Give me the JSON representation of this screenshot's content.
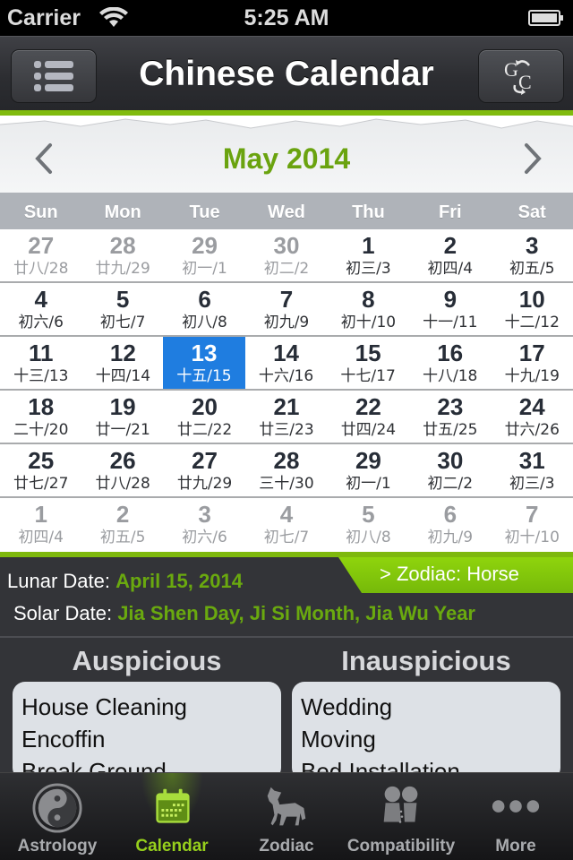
{
  "status_bar": {
    "carrier": "Carrier",
    "time": "5:25 AM",
    "wifi_icon": "wifi-icon",
    "battery_icon": "battery-icon"
  },
  "nav": {
    "title": "Chinese Calendar",
    "left_button_icon": "list-icon",
    "right_button_icon": "gregorian-chinese-convert-icon"
  },
  "calendar": {
    "month_title": "May 2014",
    "prev_icon": "chevron-left-icon",
    "next_icon": "chevron-right-icon",
    "weekdays": [
      "Sun",
      "Mon",
      "Tue",
      "Wed",
      "Thu",
      "Fri",
      "Sat"
    ],
    "selected_color": "#1f7de0",
    "weeks": [
      [
        {
          "solar": "27",
          "lunar": "廿八/28",
          "other": true
        },
        {
          "solar": "28",
          "lunar": "廿九/29",
          "other": true
        },
        {
          "solar": "29",
          "lunar": "初一/1",
          "other": true
        },
        {
          "solar": "30",
          "lunar": "初二/2",
          "other": true
        },
        {
          "solar": "1",
          "lunar": "初三/3",
          "other": false
        },
        {
          "solar": "2",
          "lunar": "初四/4",
          "other": false
        },
        {
          "solar": "3",
          "lunar": "初五/5",
          "other": false
        }
      ],
      [
        {
          "solar": "4",
          "lunar": "初六/6",
          "other": false
        },
        {
          "solar": "5",
          "lunar": "初七/7",
          "other": false
        },
        {
          "solar": "6",
          "lunar": "初八/8",
          "other": false
        },
        {
          "solar": "7",
          "lunar": "初九/9",
          "other": false
        },
        {
          "solar": "8",
          "lunar": "初十/10",
          "other": false
        },
        {
          "solar": "9",
          "lunar": "十一/11",
          "other": false
        },
        {
          "solar": "10",
          "lunar": "十二/12",
          "other": false
        }
      ],
      [
        {
          "solar": "11",
          "lunar": "十三/13",
          "other": false
        },
        {
          "solar": "12",
          "lunar": "十四/14",
          "other": false
        },
        {
          "solar": "13",
          "lunar": "十五/15",
          "other": false,
          "selected": true
        },
        {
          "solar": "14",
          "lunar": "十六/16",
          "other": false
        },
        {
          "solar": "15",
          "lunar": "十七/17",
          "other": false
        },
        {
          "solar": "16",
          "lunar": "十八/18",
          "other": false
        },
        {
          "solar": "17",
          "lunar": "十九/19",
          "other": false
        }
      ],
      [
        {
          "solar": "18",
          "lunar": "二十/20",
          "other": false
        },
        {
          "solar": "19",
          "lunar": "廿一/21",
          "other": false
        },
        {
          "solar": "20",
          "lunar": "廿二/22",
          "other": false
        },
        {
          "solar": "21",
          "lunar": "廿三/23",
          "other": false
        },
        {
          "solar": "22",
          "lunar": "廿四/24",
          "other": false
        },
        {
          "solar": "23",
          "lunar": "廿五/25",
          "other": false
        },
        {
          "solar": "24",
          "lunar": "廿六/26",
          "other": false
        }
      ],
      [
        {
          "solar": "25",
          "lunar": "廿七/27",
          "other": false
        },
        {
          "solar": "26",
          "lunar": "廿八/28",
          "other": false
        },
        {
          "solar": "27",
          "lunar": "廿九/29",
          "other": false
        },
        {
          "solar": "28",
          "lunar": "三十/30",
          "other": false
        },
        {
          "solar": "29",
          "lunar": "初一/1",
          "other": false
        },
        {
          "solar": "30",
          "lunar": "初二/2",
          "other": false
        },
        {
          "solar": "31",
          "lunar": "初三/3",
          "other": false
        }
      ],
      [
        {
          "solar": "1",
          "lunar": "初四/4",
          "other": true
        },
        {
          "solar": "2",
          "lunar": "初五/5",
          "other": true
        },
        {
          "solar": "3",
          "lunar": "初六/6",
          "other": true
        },
        {
          "solar": "4",
          "lunar": "初七/7",
          "other": true
        },
        {
          "solar": "5",
          "lunar": "初八/8",
          "other": true
        },
        {
          "solar": "6",
          "lunar": "初九/9",
          "other": true
        },
        {
          "solar": "7",
          "lunar": "初十/10",
          "other": true
        }
      ]
    ]
  },
  "info": {
    "zodiac_link": "> Zodiac: Horse",
    "lunar_label": "Lunar Date:",
    "lunar_value": "April 15, 2014",
    "solar_label": "Solar Date:",
    "solar_value": "Jia Shen Day, Ji Si Month, Jia Wu Year",
    "auspicious_title": "Auspicious",
    "inauspicious_title": "Inauspicious",
    "auspicious": [
      "House Cleaning",
      "Encoffin",
      "Break Ground"
    ],
    "inauspicious": [
      "Wedding",
      "Moving",
      "Bed Installation"
    ]
  },
  "tabs": [
    {
      "label": "Astrology",
      "icon": "yin-yang-icon",
      "active": false
    },
    {
      "label": "Calendar",
      "icon": "calendar-icon",
      "active": true
    },
    {
      "label": "Zodiac",
      "icon": "horse-icon",
      "active": false
    },
    {
      "label": "Compatibility",
      "icon": "couple-icon",
      "active": false
    },
    {
      "label": "More",
      "icon": "more-dots-icon",
      "active": false
    }
  ]
}
